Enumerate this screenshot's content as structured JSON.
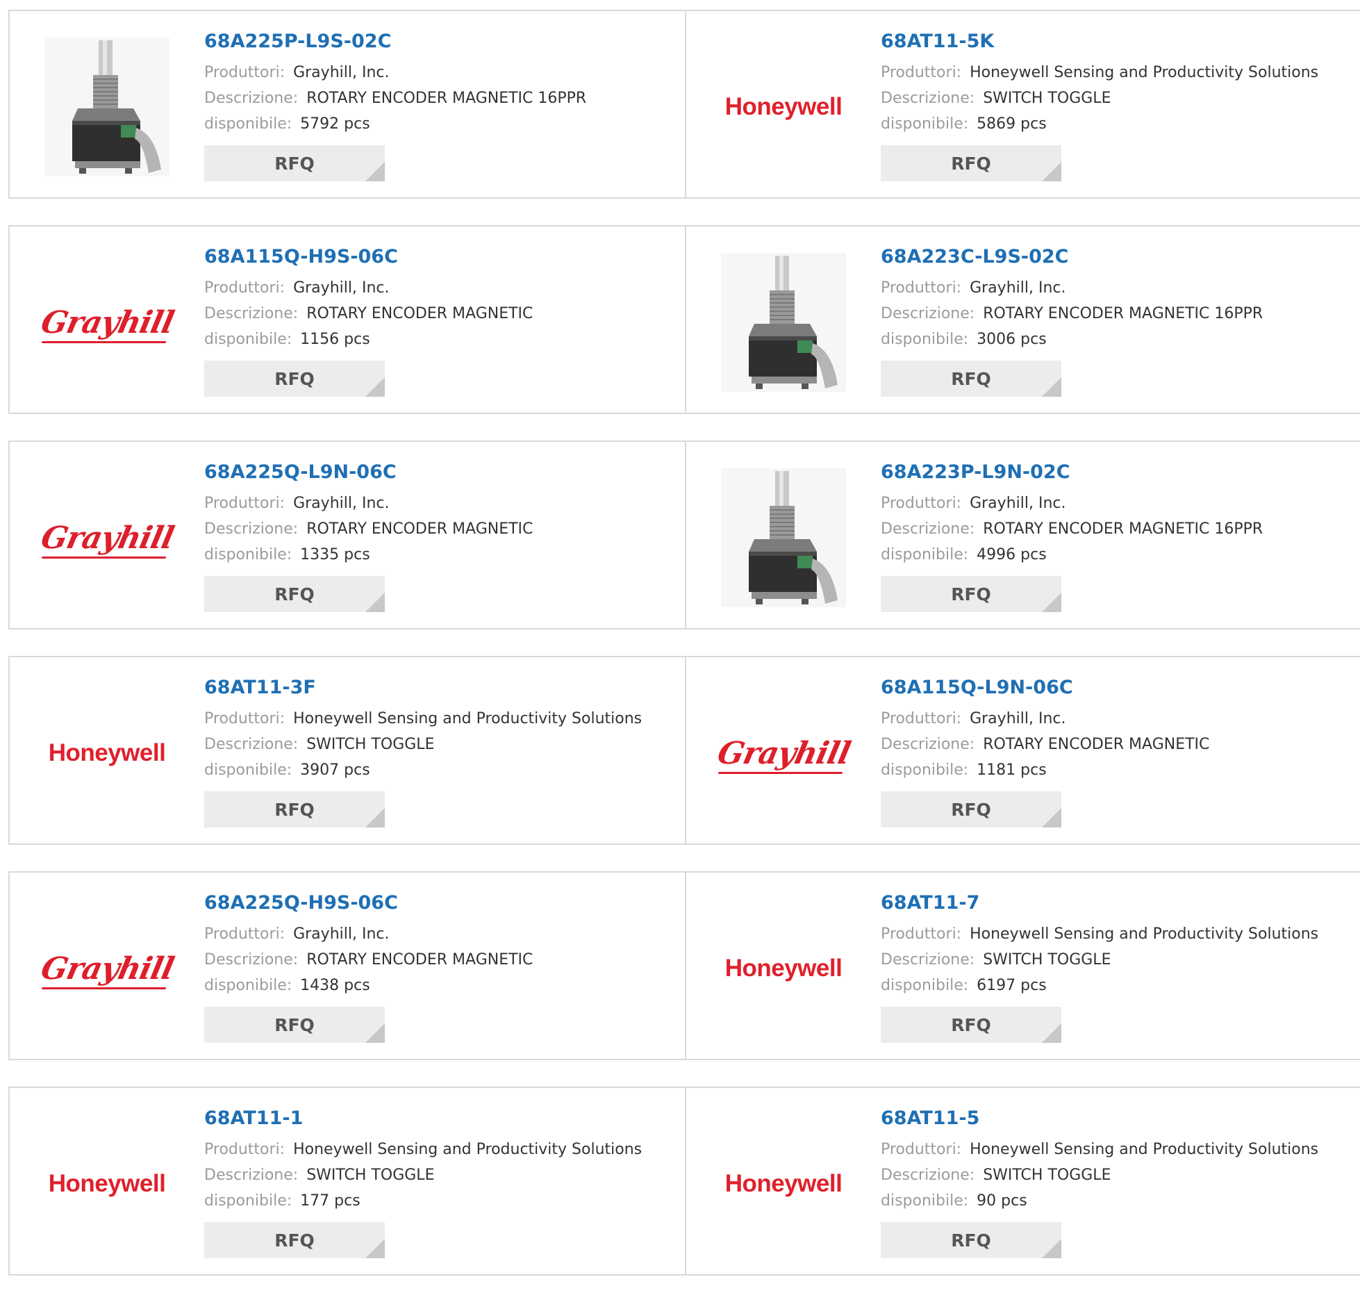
{
  "labels": {
    "manufacturer": "Produttori:",
    "description": "Descrizione:",
    "available": "disponibile:",
    "rfq": "RFQ"
  },
  "colors": {
    "part_number": "#1f6fb4",
    "label": "#9b9b9b",
    "value": "#333333",
    "honeywell_red": "#e0202b",
    "grayhill_red": "#dd1f2b",
    "rfq_bg": "#ececec"
  },
  "products": [
    {
      "part": "68A225P-L9S-02C",
      "manufacturer": "Grayhill, Inc.",
      "description": "ROTARY ENCODER MAGNETIC 16PPR",
      "stock": "5792 pcs",
      "image": "encoder-photo"
    },
    {
      "part": "68AT11-5K",
      "manufacturer": "Honeywell Sensing and Productivity Solutions",
      "description": "SWITCH TOGGLE",
      "stock": "5869 pcs",
      "image": "honeywell-logo",
      "logo_text": "Honeywell"
    },
    {
      "part": "68A115Q-H9S-06C",
      "manufacturer": "Grayhill, Inc.",
      "description": "ROTARY ENCODER MAGNETIC",
      "stock": "1156 pcs",
      "image": "grayhill-logo",
      "logo_text": "Grayhill"
    },
    {
      "part": "68A223C-L9S-02C",
      "manufacturer": "Grayhill, Inc.",
      "description": "ROTARY ENCODER MAGNETIC 16PPR",
      "stock": "3006 pcs",
      "image": "encoder-photo"
    },
    {
      "part": "68A225Q-L9N-06C",
      "manufacturer": "Grayhill, Inc.",
      "description": "ROTARY ENCODER MAGNETIC",
      "stock": "1335 pcs",
      "image": "grayhill-logo",
      "logo_text": "Grayhill"
    },
    {
      "part": "68A223P-L9N-02C",
      "manufacturer": "Grayhill, Inc.",
      "description": "ROTARY ENCODER MAGNETIC 16PPR",
      "stock": "4996 pcs",
      "image": "encoder-photo"
    },
    {
      "part": "68AT11-3F",
      "manufacturer": "Honeywell Sensing and Productivity Solutions",
      "description": "SWITCH TOGGLE",
      "stock": "3907 pcs",
      "image": "honeywell-logo",
      "logo_text": "Honeywell"
    },
    {
      "part": "68A115Q-L9N-06C",
      "manufacturer": "Grayhill, Inc.",
      "description": "ROTARY ENCODER MAGNETIC",
      "stock": "1181 pcs",
      "image": "grayhill-logo",
      "logo_text": "Grayhill"
    },
    {
      "part": "68A225Q-H9S-06C",
      "manufacturer": "Grayhill, Inc.",
      "description": "ROTARY ENCODER MAGNETIC",
      "stock": "1438 pcs",
      "image": "grayhill-logo",
      "logo_text": "Grayhill"
    },
    {
      "part": "68AT11-7",
      "manufacturer": "Honeywell Sensing and Productivity Solutions",
      "description": "SWITCH TOGGLE",
      "stock": "6197 pcs",
      "image": "honeywell-logo",
      "logo_text": "Honeywell"
    },
    {
      "part": "68AT11-1",
      "manufacturer": "Honeywell Sensing and Productivity Solutions",
      "description": "SWITCH TOGGLE",
      "stock": "177 pcs",
      "image": "honeywell-logo",
      "logo_text": "Honeywell"
    },
    {
      "part": "68AT11-5",
      "manufacturer": "Honeywell Sensing and Productivity Solutions",
      "description": "SWITCH TOGGLE",
      "stock": "90 pcs",
      "image": "honeywell-logo",
      "logo_text": "Honeywell"
    }
  ]
}
